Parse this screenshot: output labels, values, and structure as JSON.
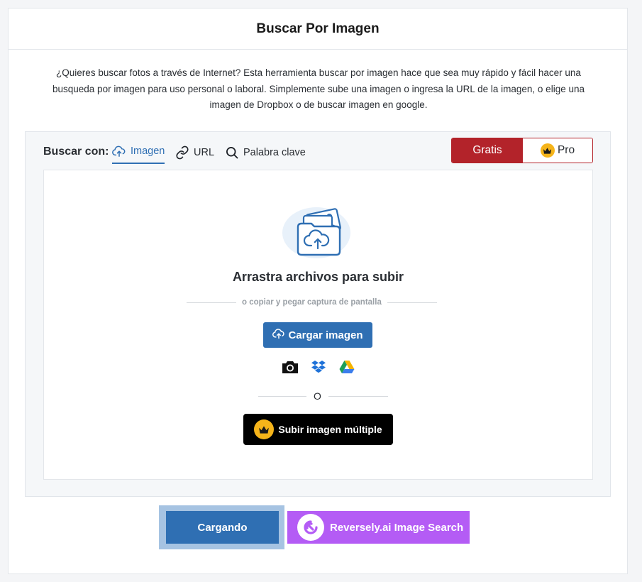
{
  "header": {
    "title": "Buscar Por Imagen"
  },
  "intro": {
    "text": "¿Quieres buscar fotos a través de Internet? Esta herramienta buscar por imagen hace que sea muy rápido y fácil hacer una busqueda por imagen para uso personal o laboral. Simplemente sube una imagen o ingresa la URL de la imagen, o elige una imagen de Dropbox o de buscar imagen en google."
  },
  "search": {
    "label": "Buscar con:",
    "tabs": [
      {
        "label": "Imagen",
        "icon": "cloud-upload-icon",
        "active": true
      },
      {
        "label": "URL",
        "icon": "link-icon",
        "active": false
      },
      {
        "label": "Palabra clave",
        "icon": "search-icon",
        "active": false
      }
    ]
  },
  "plan": {
    "free_label": "Gratis",
    "pro_label": "Pro",
    "active": "Gratis"
  },
  "upload": {
    "drag_title": "Arrastra archivos para subir",
    "paste_hint": "o copiar y pegar captura de pantalla",
    "upload_button": "Cargar imagen",
    "sources": [
      "camera-icon",
      "dropbox-icon",
      "google-drive-icon"
    ],
    "or_text": "O",
    "multi_button": "Subir imagen múltiple"
  },
  "actions": {
    "loading_button": "Cargando",
    "reversely_button": "Reversely.ai Image Search"
  },
  "colors": {
    "accent_blue": "#2f6fb3",
    "free_red": "#b3232a",
    "pro_gold": "#f5b41a",
    "reversely_purple": "#b45cf5"
  }
}
